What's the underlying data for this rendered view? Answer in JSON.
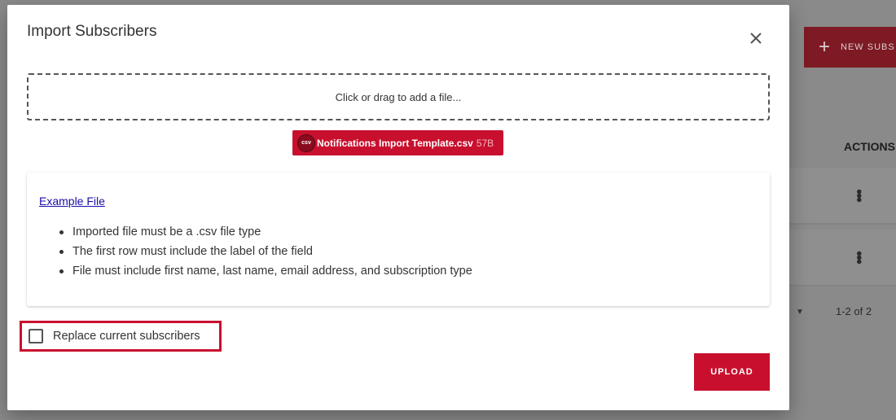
{
  "background": {
    "new_button_label": "NEW SUBS",
    "new_button_icon": "plus-icon",
    "actions_header": "ACTIONS",
    "rows": [
      {
        "menu_icon": "kebab-icon"
      },
      {
        "menu_icon": "kebab-icon"
      }
    ],
    "pagination": "1-2 of 2"
  },
  "dialog": {
    "title": "Import Subscribers",
    "close_icon": "close-icon",
    "dropzone_text": "Click or drag to add a file...",
    "template_file": {
      "icon_text": "csv",
      "name": "Notifications Import Template.csv",
      "size": "57B"
    },
    "info": {
      "example_link": "Example File",
      "rules": [
        "Imported file must be a .csv file type",
        "The first row must include the label of the field",
        "File must include first name, last name, email address, and subscription type"
      ]
    },
    "replace_checkbox": {
      "label": "Replace current subscribers",
      "checked": false
    },
    "upload_button": "UPLOAD"
  },
  "colors": {
    "accent": "#c8102e",
    "overlay": "#8a8a8a"
  }
}
